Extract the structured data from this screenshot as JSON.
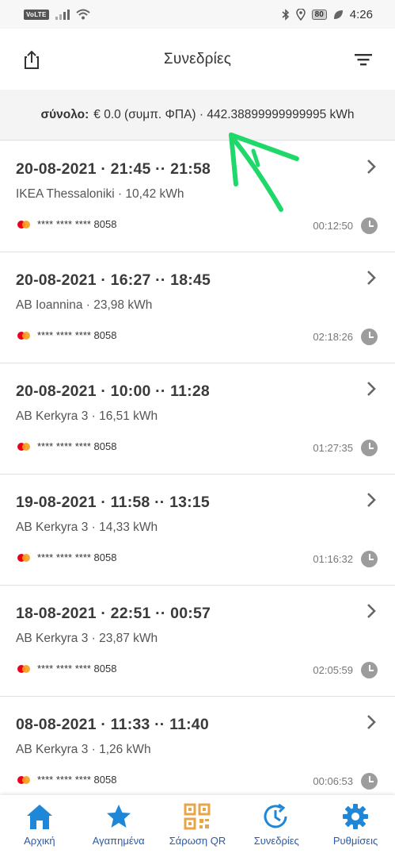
{
  "status_bar": {
    "network_badge": "VoLTE",
    "battery": "80",
    "time": "4:26"
  },
  "header": {
    "title": "Συνεδρίες",
    "icons": {
      "left": "share-icon",
      "right": "filter-icon"
    }
  },
  "summary": {
    "label": "σύνολο:",
    "value": "€ 0.0 (συμπ. ΦΠΑ) · 442.38899999999995 kWh"
  },
  "sessions": [
    {
      "datetime": "20-08-2021 · 21:45 ·· 21:58",
      "location": "IKEA Thessaloniki  · 10,42 kWh",
      "card": "**** **** **** 8058",
      "duration": "00:12:50"
    },
    {
      "datetime": "20-08-2021 · 16:27 ·· 18:45",
      "location": "AB Ioannina  · 23,98 kWh",
      "card": "**** **** **** 8058",
      "duration": "02:18:26"
    },
    {
      "datetime": "20-08-2021 · 10:00 ·· 11:28",
      "location": "AB Kerkyra 3  · 16,51 kWh",
      "card": "**** **** **** 8058",
      "duration": "01:27:35"
    },
    {
      "datetime": "19-08-2021 · 11:58 ·· 13:15",
      "location": "AB Kerkyra 3  · 14,33 kWh",
      "card": "**** **** **** 8058",
      "duration": "01:16:32"
    },
    {
      "datetime": "18-08-2021 · 22:51 ·· 00:57",
      "location": "AB Kerkyra 3  · 23,87 kWh",
      "card": "**** **** **** 8058",
      "duration": "02:05:59"
    },
    {
      "datetime": "08-08-2021 · 11:33 ·· 11:40",
      "location": "AB Kerkyra 3  · 1,26 kWh",
      "card": "**** **** **** 8058",
      "duration": "00:06:53"
    }
  ],
  "bottom_nav": [
    {
      "label": "Αρχική",
      "icon": "home-icon"
    },
    {
      "label": "Αγαπημένα",
      "icon": "star-icon"
    },
    {
      "label": "Σάρωση QR",
      "icon": "qr-code-icon"
    },
    {
      "label": "Συνεδρίες",
      "icon": "history-icon"
    },
    {
      "label": "Ρυθμίσεις",
      "icon": "settings-icon"
    }
  ],
  "colors": {
    "accent": "#2b5aa8",
    "icon_blue": "#1f87d8",
    "qr_orange": "#e8a44a",
    "annotation_green": "#1ed86a"
  }
}
